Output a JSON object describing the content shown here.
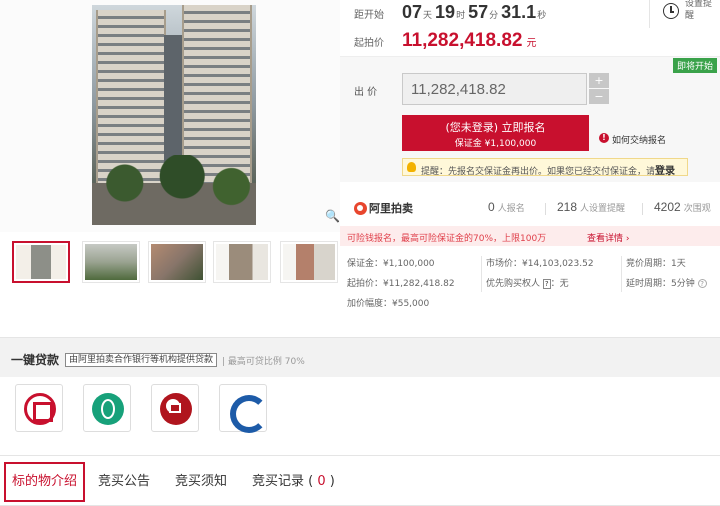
{
  "countdown": {
    "label": "距开始",
    "days": "07",
    "days_unit": "天",
    "hours": "19",
    "hours_unit": "时",
    "minutes": "57",
    "minutes_unit": "分",
    "seconds": "31.1",
    "seconds_unit": "秒"
  },
  "reminder": {
    "label": "设置提醒"
  },
  "start_price": {
    "label": "起拍价",
    "value": "11,282,418.82",
    "unit": "元"
  },
  "status_tag": "即将开始",
  "bid": {
    "label": "出 价",
    "value": "11,282,418.82",
    "plus": "+",
    "minus": "−"
  },
  "register_button": {
    "line1": "(您未登录) 立即报名",
    "line2": "保证金 ¥1,100,000"
  },
  "how_to_pay": "如何交纳报名",
  "tip": {
    "text": "提醒：先报名交保证金再出价。如果您已经交付保证金，请",
    "login": "登录"
  },
  "brand": {
    "name": "阿里拍卖"
  },
  "stats": [
    {
      "n": "0",
      "t": "人报名"
    },
    {
      "n": "218",
      "t": "人设置提醒"
    },
    {
      "n": "4202",
      "t": "次围观"
    }
  ],
  "loan_strip": {
    "text": "可险钱报名，最高可险保证金的70%，上限100万",
    "link": "查看详情 ›"
  },
  "info": {
    "deposit": "保证金：¥1,100,000",
    "market_price": "市场价：¥14,103,023.52",
    "cycle": "竞价周期：1天",
    "start_price": "起拍价：¥11,282,418.82",
    "priority_pre": "优先购买权人",
    "priority_badge": "?",
    "priority_post": "：无",
    "delay": "延时周期：5分钟",
    "q": "?",
    "increment": "加价幅度：¥55,000"
  },
  "loan_section": {
    "title": "一键贷款",
    "bank_tag": "由阿里拍卖合作银行等机构提供贷款",
    "ratio": "| 最高可贷比例 70%"
  },
  "banks": [
    {
      "icon": "icbc-logo-icon"
    },
    {
      "icon": "abc-logo-icon"
    },
    {
      "icon": "boc-logo-icon"
    },
    {
      "icon": "ccb-logo-icon"
    }
  ],
  "tabs": [
    {
      "label": "标的物介绍"
    },
    {
      "label": "竞买公告"
    },
    {
      "label": "竞买须知"
    },
    {
      "label": "竞买记录 (",
      "count": "0",
      "suffix": ")"
    }
  ],
  "colors": {
    "accent": "#c8102e",
    "status_green": "#3aa24a",
    "tip_bg": "#fff8d9"
  }
}
